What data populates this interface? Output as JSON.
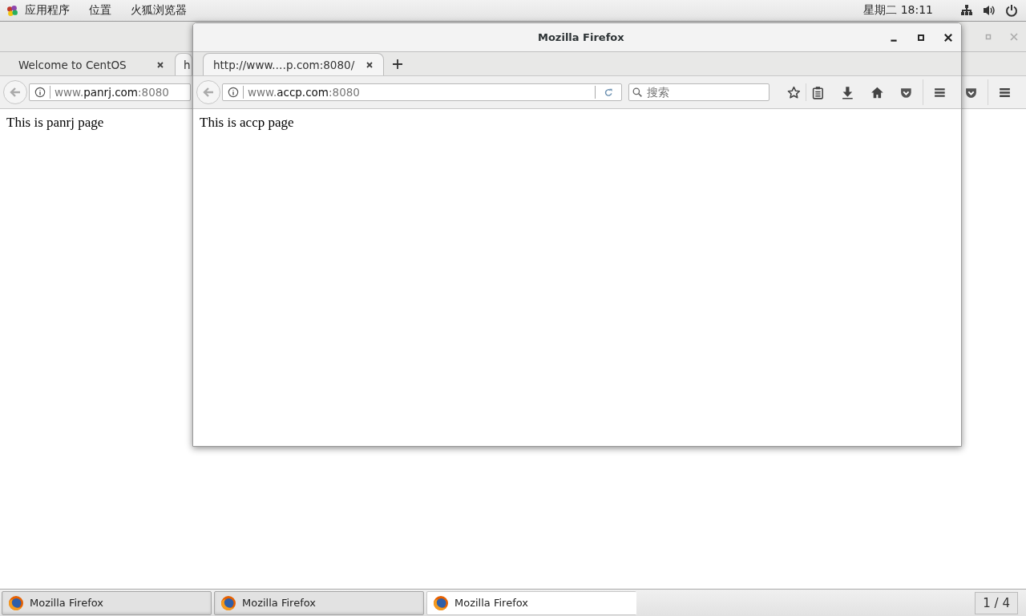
{
  "top_bar": {
    "menu": [
      "应用程序",
      "位置",
      "火狐浏览器"
    ],
    "clock": "星期二 18:11"
  },
  "back_window": {
    "tabs": [
      {
        "label": "Welcome to CentOS",
        "selected": false
      },
      {
        "label": "h",
        "selected": true
      }
    ],
    "url": {
      "prefix": "www.",
      "domain": "panrj.com",
      "port": ":8080"
    },
    "page_text": "This is panrj page"
  },
  "front_window": {
    "title": "Mozilla Firefox",
    "tabs": [
      {
        "label": "http://www.…p.com:8080/",
        "selected": true
      }
    ],
    "url": {
      "prefix": "www.",
      "domain": "accp.com",
      "port": ":8080"
    },
    "search": {
      "placeholder": "搜索"
    },
    "page_text": "This is accp page"
  },
  "taskbar": {
    "items": [
      {
        "label": "Mozilla Firefox",
        "selected": false
      },
      {
        "label": "Mozilla Firefox",
        "selected": false
      },
      {
        "label": "Mozilla Firefox",
        "selected": true
      }
    ],
    "workspace": "1 / 4"
  }
}
